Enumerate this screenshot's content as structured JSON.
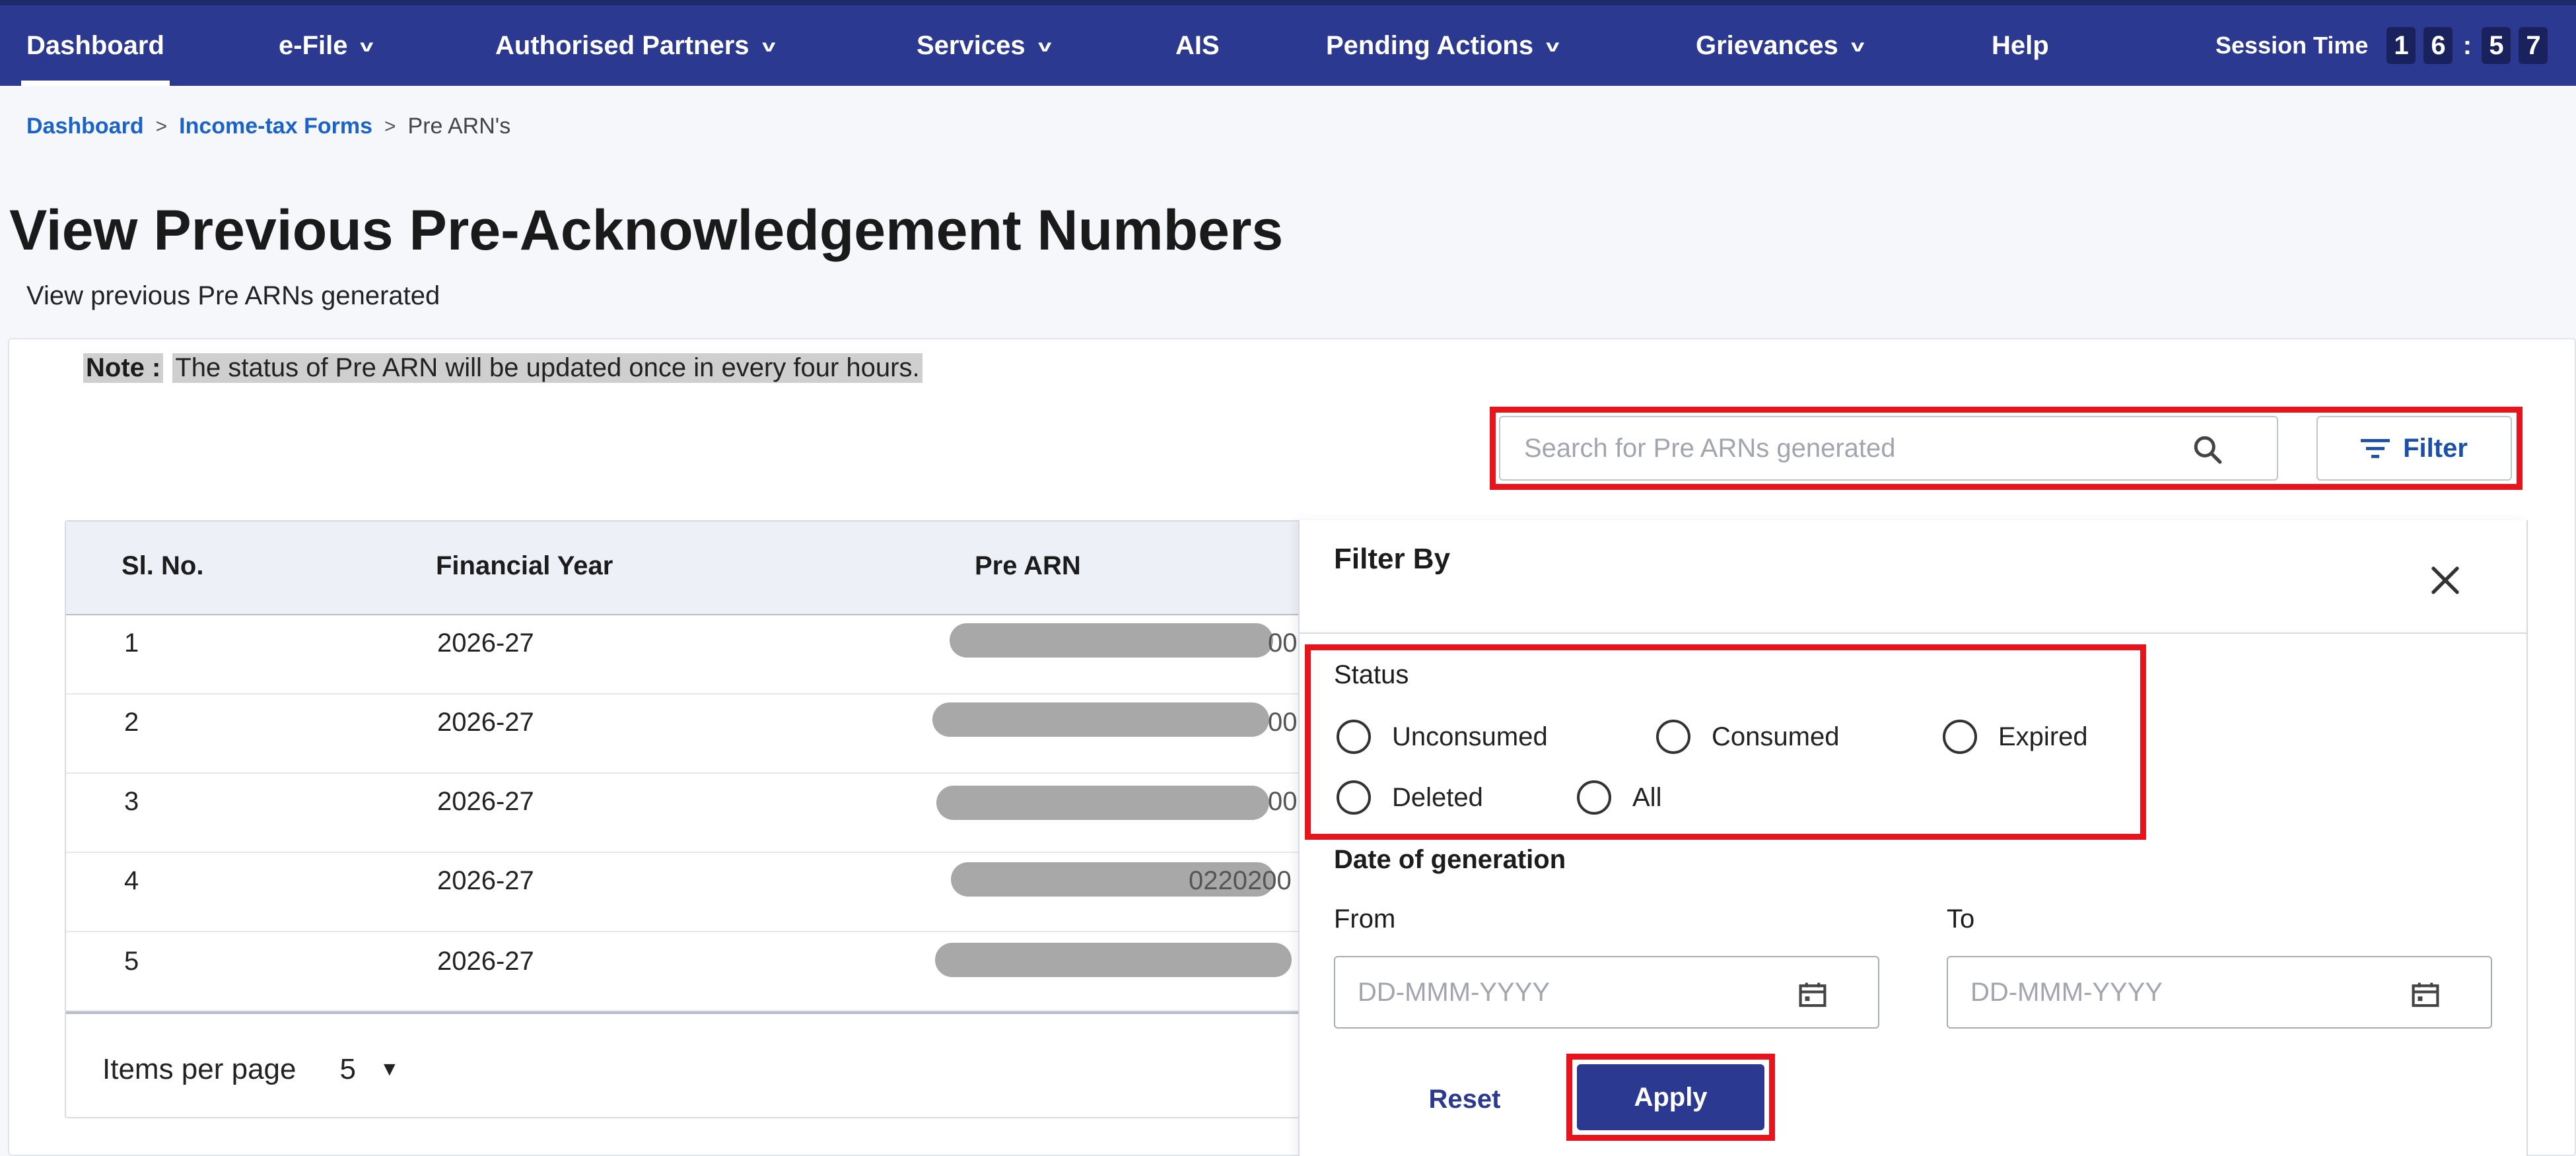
{
  "nav": {
    "items": [
      {
        "label": "Dashboard",
        "dropdown": false
      },
      {
        "label": "e-File",
        "dropdown": true
      },
      {
        "label": "Authorised Partners",
        "dropdown": true
      },
      {
        "label": "Services",
        "dropdown": true
      },
      {
        "label": "AIS",
        "dropdown": false
      },
      {
        "label": "Pending Actions",
        "dropdown": true
      },
      {
        "label": "Grievances",
        "dropdown": true
      },
      {
        "label": "Help",
        "dropdown": false
      }
    ],
    "session_label": "Session Time",
    "session_digits": [
      "1",
      "6",
      ":",
      "5",
      "7"
    ]
  },
  "breadcrumb": {
    "items": [
      "Dashboard",
      "Income-tax Forms",
      "Pre ARN's"
    ],
    "separator": ">"
  },
  "page": {
    "title": "View Previous Pre-Acknowledgement Numbers",
    "subtitle": "View previous Pre ARNs generated"
  },
  "note": {
    "label": "Note :",
    "text": "The status of Pre ARN will be updated once in every four hours."
  },
  "search": {
    "placeholder": "Search for Pre ARNs generated",
    "value": ""
  },
  "filter_button": {
    "label": "Filter"
  },
  "table": {
    "columns": [
      "Sl. No.",
      "Financial Year",
      "Pre ARN"
    ],
    "rows": [
      {
        "sl": "1",
        "fy": "2026-27",
        "arn_tail": "00"
      },
      {
        "sl": "2",
        "fy": "2026-27",
        "arn_tail": "00"
      },
      {
        "sl": "3",
        "fy": "2026-27",
        "arn_tail": "00"
      },
      {
        "sl": "4",
        "fy": "2026-27",
        "arn_tail": "0220200"
      },
      {
        "sl": "5",
        "fy": "2026-27",
        "arn_tail": ""
      }
    ],
    "items_per_page_label": "Items per page",
    "items_per_page_value": "5"
  },
  "filter_panel": {
    "title": "Filter By",
    "status_label": "Status",
    "status_options": [
      "Unconsumed",
      "Consumed",
      "Expired",
      "Deleted",
      "All"
    ],
    "date_label": "Date of generation",
    "from_label": "From",
    "to_label": "To",
    "date_placeholder": "DD-MMM-YYYY",
    "reset_label": "Reset",
    "apply_label": "Apply"
  },
  "colors": {
    "nav_bg": "#2b3990",
    "highlight_frame": "#e8131b",
    "link": "#1b63c6",
    "apply_bg": "#2b3990"
  },
  "icons": [
    "chevron-down-icon",
    "search-icon",
    "filter-icon",
    "close-icon",
    "calendar-icon",
    "caret-down-icon"
  ]
}
